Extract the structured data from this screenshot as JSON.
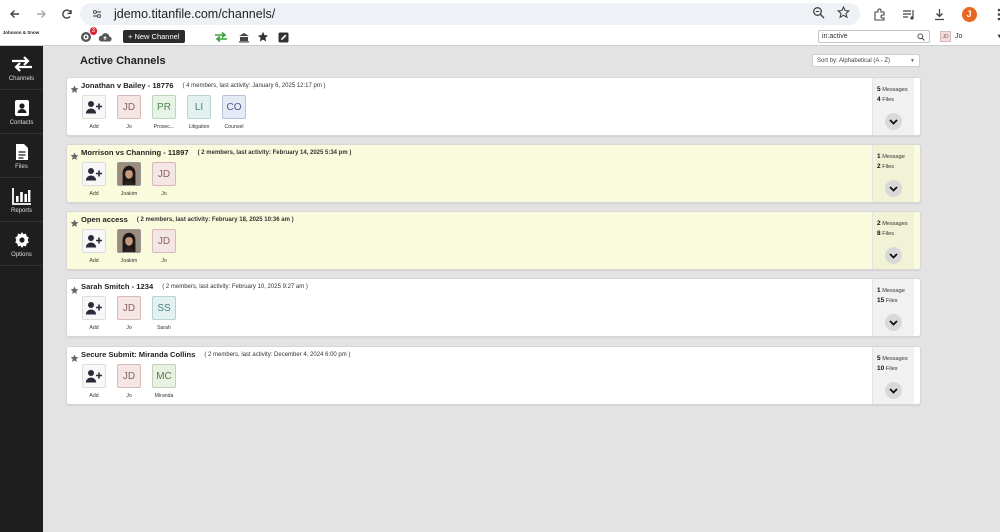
{
  "browser": {
    "url": "jdemo.titanfile.com/channels/",
    "profile_initial": "J"
  },
  "appbar": {
    "brand": "Johnson & Snow",
    "notification_count": "3",
    "new_channel_label": "+ New Channel",
    "search_value": "in:active",
    "user_initials": "JD",
    "user_name": "Jo"
  },
  "sidebar": {
    "items": [
      {
        "label": "Channels",
        "icon": "arrows-exchange-icon"
      },
      {
        "label": "Contacts",
        "icon": "contacts-icon"
      },
      {
        "label": "Files",
        "icon": "files-icon"
      },
      {
        "label": "Reports",
        "icon": "bar-chart-icon"
      },
      {
        "label": "Options",
        "icon": "gear-icon"
      }
    ]
  },
  "main": {
    "title": "Active Channels",
    "sort_label": "Sort by: Alphabetical (A - Z)"
  },
  "channels": [
    {
      "name": "Jonathan v Bailey - 18776",
      "meta": "( 4 members, last activity: January 6, 2025 12:17 pm )",
      "highlighted": false,
      "add_label": "Add",
      "members": [
        {
          "initials": "JD",
          "label": "Jo",
          "bg": "#f5e6e6",
          "border": "#d9b8b8",
          "color": "#8c5d5d"
        },
        {
          "initials": "PR",
          "label": "Prosec...",
          "bg": "#e6f3e6",
          "border": "#b9d6b9",
          "color": "#4f8a4f"
        },
        {
          "initials": "LI",
          "label": "Litigation",
          "bg": "#e3f1f0",
          "border": "#b6d4d2",
          "color": "#4a8582"
        },
        {
          "initials": "CO",
          "label": "Counsel",
          "bg": "#e6e9f6",
          "border": "#b9bfdc",
          "color": "#4c578c"
        }
      ],
      "messages_count": "5",
      "messages_word": "Messages",
      "files_count": "4",
      "files_word": "Files"
    },
    {
      "name": "Morrison vs Channing - 11897",
      "meta": "( 2 members, last activity: February 14, 2025 5:34 pm )",
      "highlighted": true,
      "add_label": "Add",
      "members": [
        {
          "photo": true,
          "label": "Joakim"
        },
        {
          "initials": "JD",
          "label": "Jo",
          "bg": "#f5e6e6",
          "border": "#d9b8b8",
          "color": "#8c5d5d"
        }
      ],
      "messages_count": "1",
      "messages_word": "Message",
      "files_count": "2",
      "files_word": "Files"
    },
    {
      "name": "Open access",
      "meta": "( 2 members, last activity: February 18, 2025 10:36 am )",
      "highlighted": true,
      "add_label": "Add",
      "members": [
        {
          "photo": true,
          "label": "Joakim"
        },
        {
          "initials": "JD",
          "label": "Jo",
          "bg": "#f5e6e6",
          "border": "#d9b8b8",
          "color": "#8c5d5d"
        }
      ],
      "messages_count": "2",
      "messages_word": "Messages",
      "files_count": "8",
      "files_word": "Files"
    },
    {
      "name": "Sarah Smitch - 1234",
      "meta": "( 2 members, last activity: February 10, 2025 9:27 am )",
      "highlighted": false,
      "add_label": "Add",
      "members": [
        {
          "initials": "JD",
          "label": "Jo",
          "bg": "#f5e6e6",
          "border": "#d9b8b8",
          "color": "#8c5d5d"
        },
        {
          "initials": "SS",
          "label": "Sarah",
          "bg": "#e3f1f0",
          "border": "#b6d4d2",
          "color": "#4a8582"
        }
      ],
      "messages_count": "1",
      "messages_word": "Message",
      "files_count": "15",
      "files_word": "Files"
    },
    {
      "name": "Secure Submit: Miranda Collins",
      "meta": "( 2 members, last activity: December 4, 2024 6:00 pm )",
      "highlighted": false,
      "add_label": "Add",
      "members": [
        {
          "initials": "JD",
          "label": "Jo",
          "bg": "#f5e6e6",
          "border": "#d9b8b8",
          "color": "#8c5d5d"
        },
        {
          "initials": "MC",
          "label": "Miranda",
          "bg": "#e9f1e3",
          "border": "#c2d4b5",
          "color": "#5b7a45"
        }
      ],
      "messages_count": "5",
      "messages_word": "Messages",
      "files_count": "10",
      "files_word": "Files"
    }
  ]
}
